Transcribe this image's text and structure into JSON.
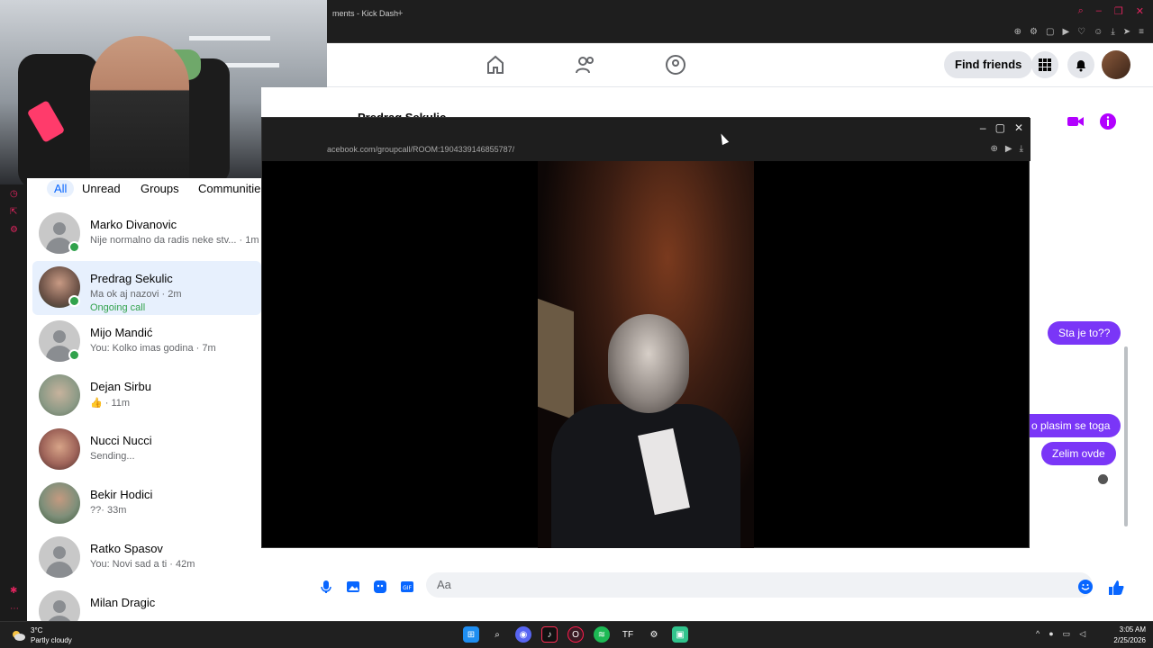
{
  "browser": {
    "tab_title": "ments - Kick Dash",
    "new_tab": "+"
  },
  "facebook": {
    "find_friends": "Find friends"
  },
  "chat_filters": [
    "All",
    "Unread",
    "Groups",
    "Communitie"
  ],
  "chats": [
    {
      "name": "Marko Divanovic",
      "snippet": "Nije normalno da radis neke stv... · 1m",
      "status": "",
      "online": true
    },
    {
      "name": "Predrag Sekulic",
      "snippet": "Ma ok aj nazovi · 2m",
      "status": "Ongoing call",
      "online": true
    },
    {
      "name": "Mijo Mandić",
      "snippet": "You: Kolko imas godina · 7m",
      "status": "",
      "online": true
    },
    {
      "name": "Dejan Sirbu",
      "snippet": "👍 · 11m",
      "status": "",
      "online": false
    },
    {
      "name": "Nucci Nucci",
      "snippet": "Sending...",
      "status": "",
      "online": false
    },
    {
      "name": "Bekir Hodici",
      "snippet": "??· 33m",
      "status": "",
      "online": false
    },
    {
      "name": "Ratko Spasov",
      "snippet": "You: Novi sad a ti · 42m",
      "status": "",
      "online": false
    },
    {
      "name": "Milan Dragic",
      "snippet": "",
      "status": "",
      "online": false
    }
  ],
  "conversation": {
    "header_name": "Predrag Sekulic",
    "messages": [
      "Sta je to??",
      "o plasim se toga",
      "Zelim ovde"
    ],
    "composer_placeholder": "Aa"
  },
  "call_window": {
    "url": "acebook.com/groupcall/ROOM:1904339146855787/"
  },
  "taskbar": {
    "temperature": "3°C",
    "condition": "Partly cloudy",
    "time": "3:05 AM",
    "date": "2/25/2026"
  },
  "colors": {
    "messenger_purple": "#7a36f7",
    "online_green": "#31a24c",
    "accent_red": "#e0245e",
    "link_blue": "#0866ff"
  }
}
